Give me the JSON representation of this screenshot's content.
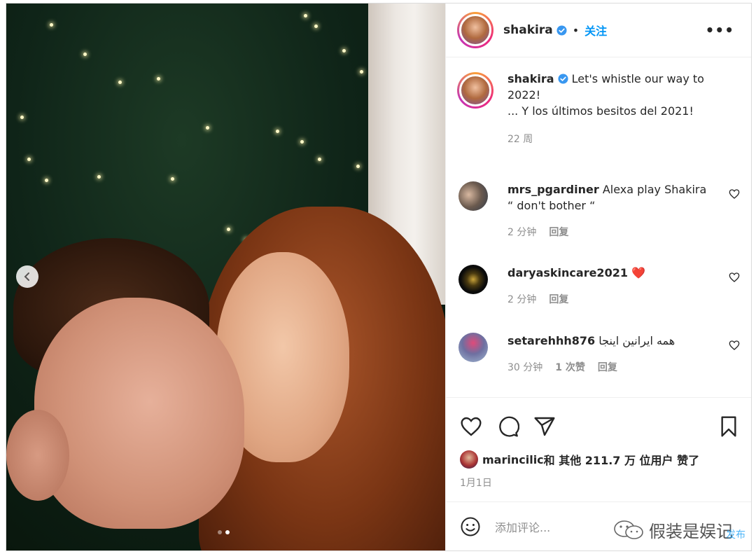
{
  "post": {
    "author": "shakira",
    "follow_label": "关注",
    "separator": "•",
    "more_label": "•••",
    "caption_user": "shakira",
    "caption_line1": " Let's whistle our way to 2022!",
    "caption_line2": "... Y los últimos besitos del 2021!",
    "caption_time": "22 周",
    "likes_user": "marincilic",
    "likes_text": " 和 其他 211.7 万 位用户 赞了",
    "date": "1月1日",
    "comment_placeholder": "添加评论..."
  },
  "comments": [
    {
      "user": "mrs_pgardiner",
      "text": " Alexa play Shakira “ don't bother “",
      "time": "2 分钟",
      "likes": "",
      "reply": "回复"
    },
    {
      "user": "daryaskincare2021",
      "text": " ❤️",
      "time": "2 分钟",
      "likes": "",
      "reply": "回复"
    },
    {
      "user": "setarehhh876",
      "text": " همه ایرانین اینجا",
      "time": "30 分钟",
      "likes": "1 次赞",
      "reply": "回复"
    }
  ],
  "watermark": {
    "text": "假装是娱记",
    "sub": "发布"
  },
  "icons": [
    "verified-badge-icon",
    "heart-icon",
    "comment-icon",
    "share-icon",
    "bookmark-icon",
    "emoji-icon",
    "chevron-left-icon",
    "wechat-icon"
  ],
  "colors": {
    "accent": "#0095f6",
    "verified": "#3897f0",
    "text": "#262626",
    "muted": "#8e8e8e"
  }
}
